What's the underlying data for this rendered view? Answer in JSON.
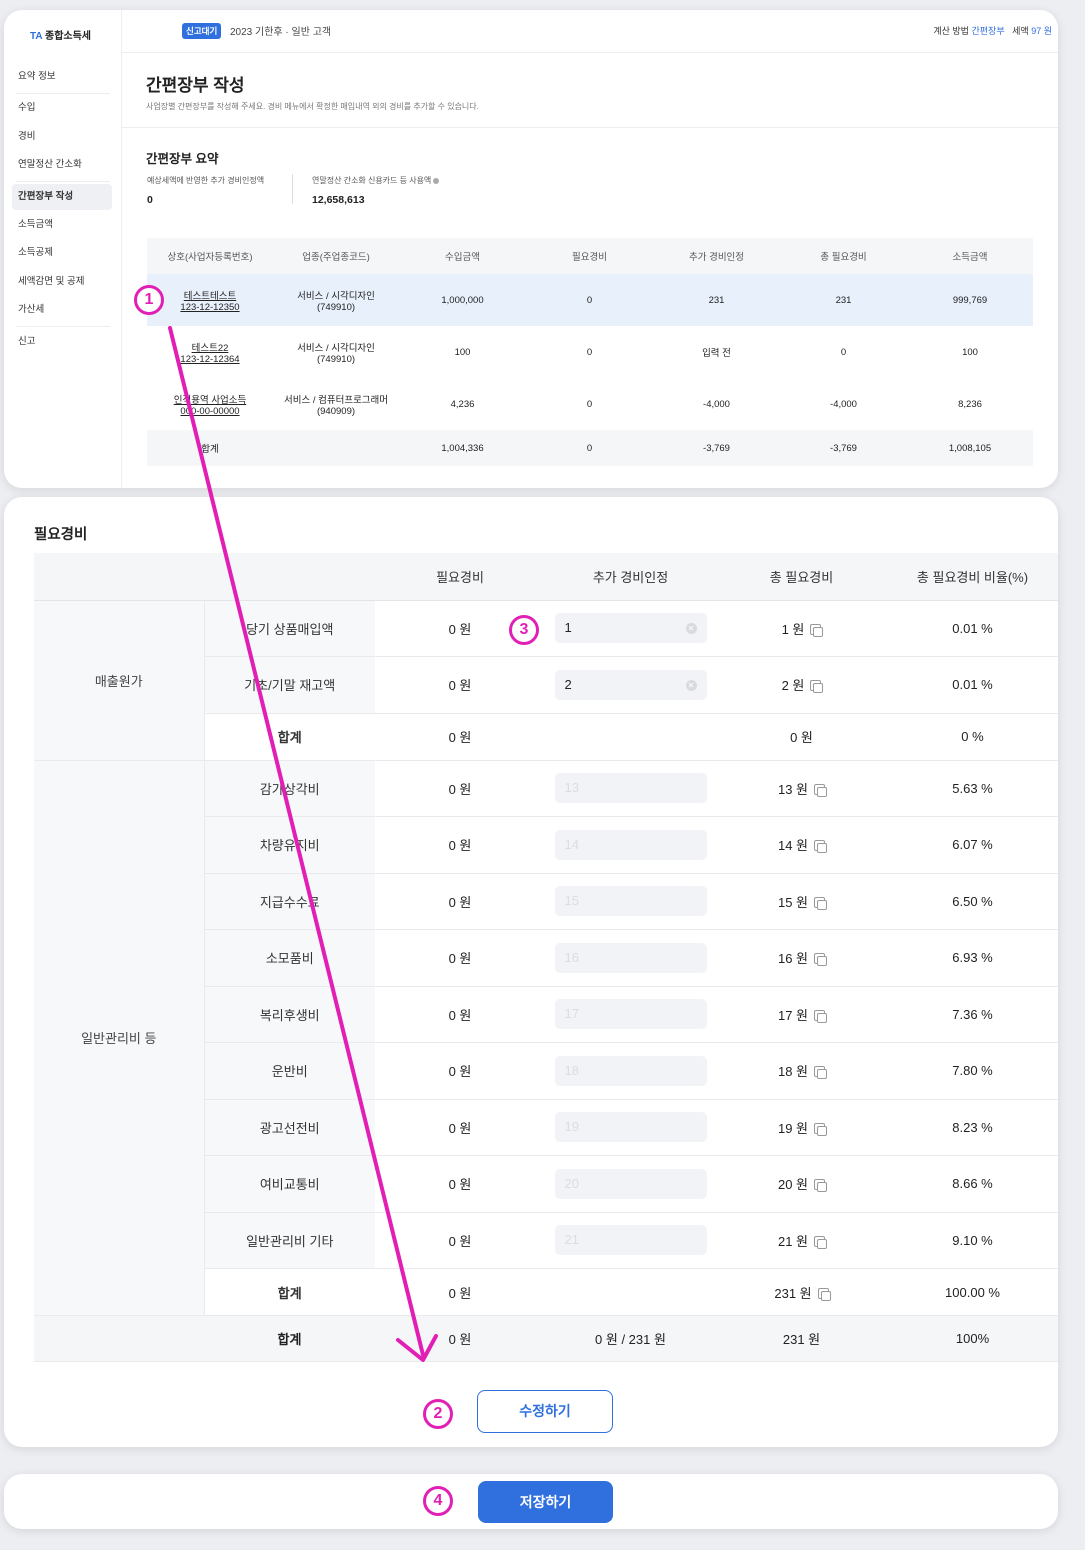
{
  "sidebar": {
    "logo_ta": "TA",
    "logo_text": "종합소득세",
    "items": [
      {
        "label": "요약 정보"
      },
      {
        "label": "수입"
      },
      {
        "label": "경비"
      },
      {
        "label": "연말정산 간소화"
      },
      {
        "label": "간편장부 작성"
      },
      {
        "label": "소득금액"
      },
      {
        "label": "소득공제"
      },
      {
        "label": "세액감면 및 공제"
      },
      {
        "label": "가산세"
      },
      {
        "label": "신고"
      }
    ]
  },
  "topbar": {
    "badge": "신고대기",
    "period": "2023 기한후 · 일반 고객",
    "method_label": "계산 방법",
    "method_value": "간편장부",
    "tax_label": "세액",
    "tax_value": "97 원"
  },
  "header": {
    "title": "간편장부 작성",
    "description": "사업장별 간편장부를 작성해 주세요. 경비 메뉴에서 확정한 매입내역 외의 경비를 추가할 수 있습니다."
  },
  "summary": {
    "title": "간편장부 요약",
    "stat1_label": "예상세액에 반영한 추가 경비인정액",
    "stat1_value": "0",
    "stat2_label": "연말정산 간소화 신용카드 등 사용액",
    "stat2_value": "12,658,613",
    "columns": [
      "상호(사업자등록번호)",
      "업종(주업종코드)",
      "수입금액",
      "필요경비",
      "추가 경비인정",
      "총 필요경비",
      "소득금액"
    ],
    "rows": [
      {
        "name": "테스트테스트",
        "reg": "123-12-12350",
        "ind1": "서비스 / 시각디자인",
        "ind2": "(749910)",
        "income": "1,000,000",
        "need": "0",
        "extra": "231",
        "total": "231",
        "profit": "999,769"
      },
      {
        "name": "테스트22",
        "reg": "123-12-12364",
        "ind1": "서비스 / 시각디자인",
        "ind2": "(749910)",
        "income": "100",
        "need": "0",
        "extra": "입력 전",
        "total": "0",
        "profit": "100"
      },
      {
        "name": "인적용역 사업소득",
        "reg": "000-00-00000",
        "ind1": "서비스 / 컴퓨터프로그래머",
        "ind2": "(940909)",
        "income": "4,236",
        "need": "0",
        "extra": "-4,000",
        "total": "-4,000",
        "profit": "8,236"
      }
    ],
    "total": {
      "label": "합계",
      "income": "1,004,336",
      "need": "0",
      "extra": "-3,769",
      "total": "-3,769",
      "profit": "1,008,105"
    }
  },
  "expense": {
    "title": "필요경비",
    "columns": [
      "필요경비",
      "추가 경비인정",
      "총 필요경비",
      "총 필요경비 비율(%)"
    ],
    "group1": "매출원가",
    "group1_rows": [
      {
        "cat": "당기 상품매입액",
        "need": "0 원",
        "input": "1",
        "total": "1 원",
        "ratio": "0.01 %"
      },
      {
        "cat": "기초/기말 재고액",
        "need": "0 원",
        "input": "2",
        "total": "2 원",
        "ratio": "0.01 %"
      }
    ],
    "group1_sum": {
      "label": "합계",
      "need": "0 원",
      "total": "0 원",
      "ratio": "0 %"
    },
    "group2": "일반관리비 등",
    "group2_rows": [
      {
        "cat": "감가상각비",
        "need": "0 원",
        "input": "13",
        "total": "13 원",
        "ratio": "5.63 %"
      },
      {
        "cat": "차량유지비",
        "need": "0 원",
        "input": "14",
        "total": "14 원",
        "ratio": "6.07 %"
      },
      {
        "cat": "지급수수료",
        "need": "0 원",
        "input": "15",
        "total": "15 원",
        "ratio": "6.50 %"
      },
      {
        "cat": "소모품비",
        "need": "0 원",
        "input": "16",
        "total": "16 원",
        "ratio": "6.93 %"
      },
      {
        "cat": "복리후생비",
        "need": "0 원",
        "input": "17",
        "total": "17 원",
        "ratio": "7.36 %"
      },
      {
        "cat": "운반비",
        "need": "0 원",
        "input": "18",
        "total": "18 원",
        "ratio": "7.80 %"
      },
      {
        "cat": "광고선전비",
        "need": "0 원",
        "input": "19",
        "total": "19 원",
        "ratio": "8.23 %"
      },
      {
        "cat": "여비교통비",
        "need": "0 원",
        "input": "20",
        "total": "20 원",
        "ratio": "8.66 %"
      },
      {
        "cat": "일반관리비 기타",
        "need": "0 원",
        "input": "21",
        "total": "21 원",
        "ratio": "9.10 %"
      }
    ],
    "group2_sum": {
      "label": "합계",
      "need": "0 원",
      "total": "231 원",
      "ratio": "100.00 %"
    },
    "grand": {
      "label": "합계",
      "need": "0 원",
      "extra": "0 원 / 231 원",
      "total": "231 원",
      "ratio": "100%"
    },
    "edit_button": "수정하기"
  },
  "footer": {
    "save_button": "저장하기"
  },
  "markers": [
    "1",
    "2",
    "3",
    "4"
  ],
  "colors": {
    "accent": "#2f6fde",
    "annotation": "#e21fb5",
    "selected_row": "#e8f0fc"
  }
}
